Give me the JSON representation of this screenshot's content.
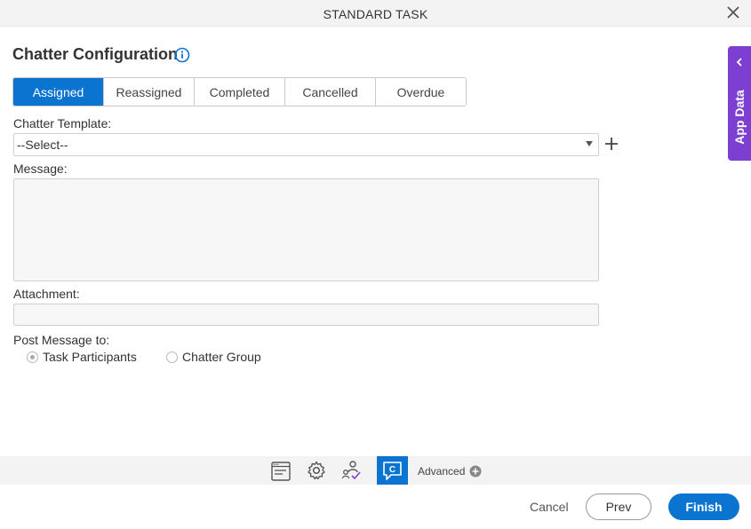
{
  "window": {
    "title": "STANDARD TASK",
    "close_icon": "close-icon"
  },
  "heading": {
    "title": "Chatter Configuration",
    "info_icon": "info-icon"
  },
  "tabs": [
    {
      "label": "Assigned",
      "active": true
    },
    {
      "label": "Reassigned",
      "active": false
    },
    {
      "label": "Completed",
      "active": false
    },
    {
      "label": "Cancelled",
      "active": false
    },
    {
      "label": "Overdue",
      "active": false
    }
  ],
  "form": {
    "chatter_template_label": "Chatter Template:",
    "chatter_template_value": "--Select--",
    "message_label": "Message:",
    "message_value": "",
    "attachment_label": "Attachment:",
    "attachment_value": "",
    "post_message_label": "Post Message to:",
    "post_options": [
      {
        "label": "Task Participants",
        "checked": true
      },
      {
        "label": "Chatter Group",
        "checked": false
      }
    ]
  },
  "side_panel": {
    "label": "App Data"
  },
  "bottom_toolbar": {
    "icons": [
      "form-icon",
      "settings-gear-icon",
      "participants-icon",
      "chatter-icon"
    ],
    "advanced_label": "Advanced"
  },
  "footer": {
    "cancel_label": "Cancel",
    "prev_label": "Prev",
    "finish_label": "Finish"
  },
  "colors": {
    "accent": "#0b74d1",
    "app_data": "#7d3fd1"
  }
}
